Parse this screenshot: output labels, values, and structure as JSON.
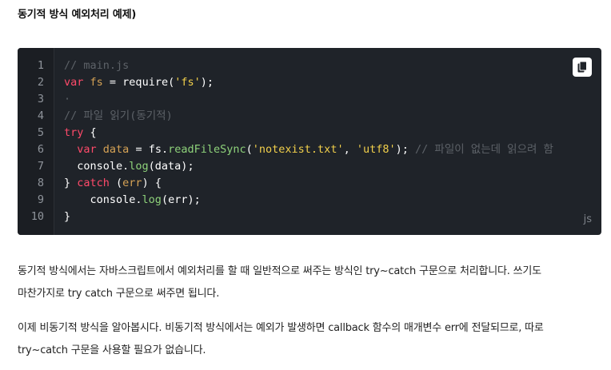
{
  "heading": "동기적 방식 예외처리 예제)",
  "code": {
    "language": "js",
    "copy_icon": "copy-icon",
    "lines": [
      {
        "n": "1",
        "tokens": [
          [
            "c-comment",
            "// main.js"
          ]
        ]
      },
      {
        "n": "2",
        "tokens": [
          [
            "c-kw",
            "var"
          ],
          [
            "c-plain",
            " "
          ],
          [
            "c-var",
            "fs"
          ],
          [
            "c-plain",
            " = require("
          ],
          [
            "c-str",
            "'fs'"
          ],
          [
            "c-plain",
            ");"
          ]
        ]
      },
      {
        "n": "3",
        "tokens": [
          [
            "c-comment",
            "·"
          ]
        ]
      },
      {
        "n": "4",
        "tokens": [
          [
            "c-comment",
            "// 파일 읽기(동기적)"
          ]
        ]
      },
      {
        "n": "5",
        "tokens": [
          [
            "c-kw",
            "try"
          ],
          [
            "c-plain",
            " {"
          ]
        ]
      },
      {
        "n": "6",
        "tokens": [
          [
            "c-plain",
            "  "
          ],
          [
            "c-kw",
            "var"
          ],
          [
            "c-plain",
            " "
          ],
          [
            "c-var",
            "data"
          ],
          [
            "c-plain",
            " = fs."
          ],
          [
            "c-fn",
            "readFileSync"
          ],
          [
            "c-plain",
            "("
          ],
          [
            "c-str",
            "'notexist.txt'"
          ],
          [
            "c-plain",
            ", "
          ],
          [
            "c-str",
            "'utf8'"
          ],
          [
            "c-plain",
            "); "
          ],
          [
            "c-comment",
            "// 파일이 없는데 읽으려 함"
          ]
        ]
      },
      {
        "n": "7",
        "tokens": [
          [
            "c-plain",
            "  console."
          ],
          [
            "c-fn",
            "log"
          ],
          [
            "c-plain",
            "(data);"
          ]
        ]
      },
      {
        "n": "8",
        "tokens": [
          [
            "c-plain",
            "} "
          ],
          [
            "c-kw",
            "catch"
          ],
          [
            "c-plain",
            " ("
          ],
          [
            "c-var",
            "err"
          ],
          [
            "c-plain",
            ") {"
          ]
        ]
      },
      {
        "n": "9",
        "tokens": [
          [
            "c-plain",
            "    console."
          ],
          [
            "c-fn",
            "log"
          ],
          [
            "c-plain",
            "(err);"
          ]
        ]
      },
      {
        "n": "10",
        "tokens": [
          [
            "c-plain",
            "}"
          ]
        ]
      }
    ]
  },
  "paragraphs": [
    [
      "동기적 방식에서는 자바스크립트에서 예외처리를 할 때 일반적으로 써주는 방식인 try~catch 구문으로 처리합니다. 쓰기도",
      "마찬가지로 try catch 구문으로 써주면 됩니다."
    ],
    [
      "이제 비동기적 방식을 알아봅시다. 비동기적 방식에서는 예외가 발생하면 callback 함수의 매개변수 err에 전달되므로, 따로",
      "try~catch 구문을 사용할 필요가 없습니다."
    ]
  ]
}
